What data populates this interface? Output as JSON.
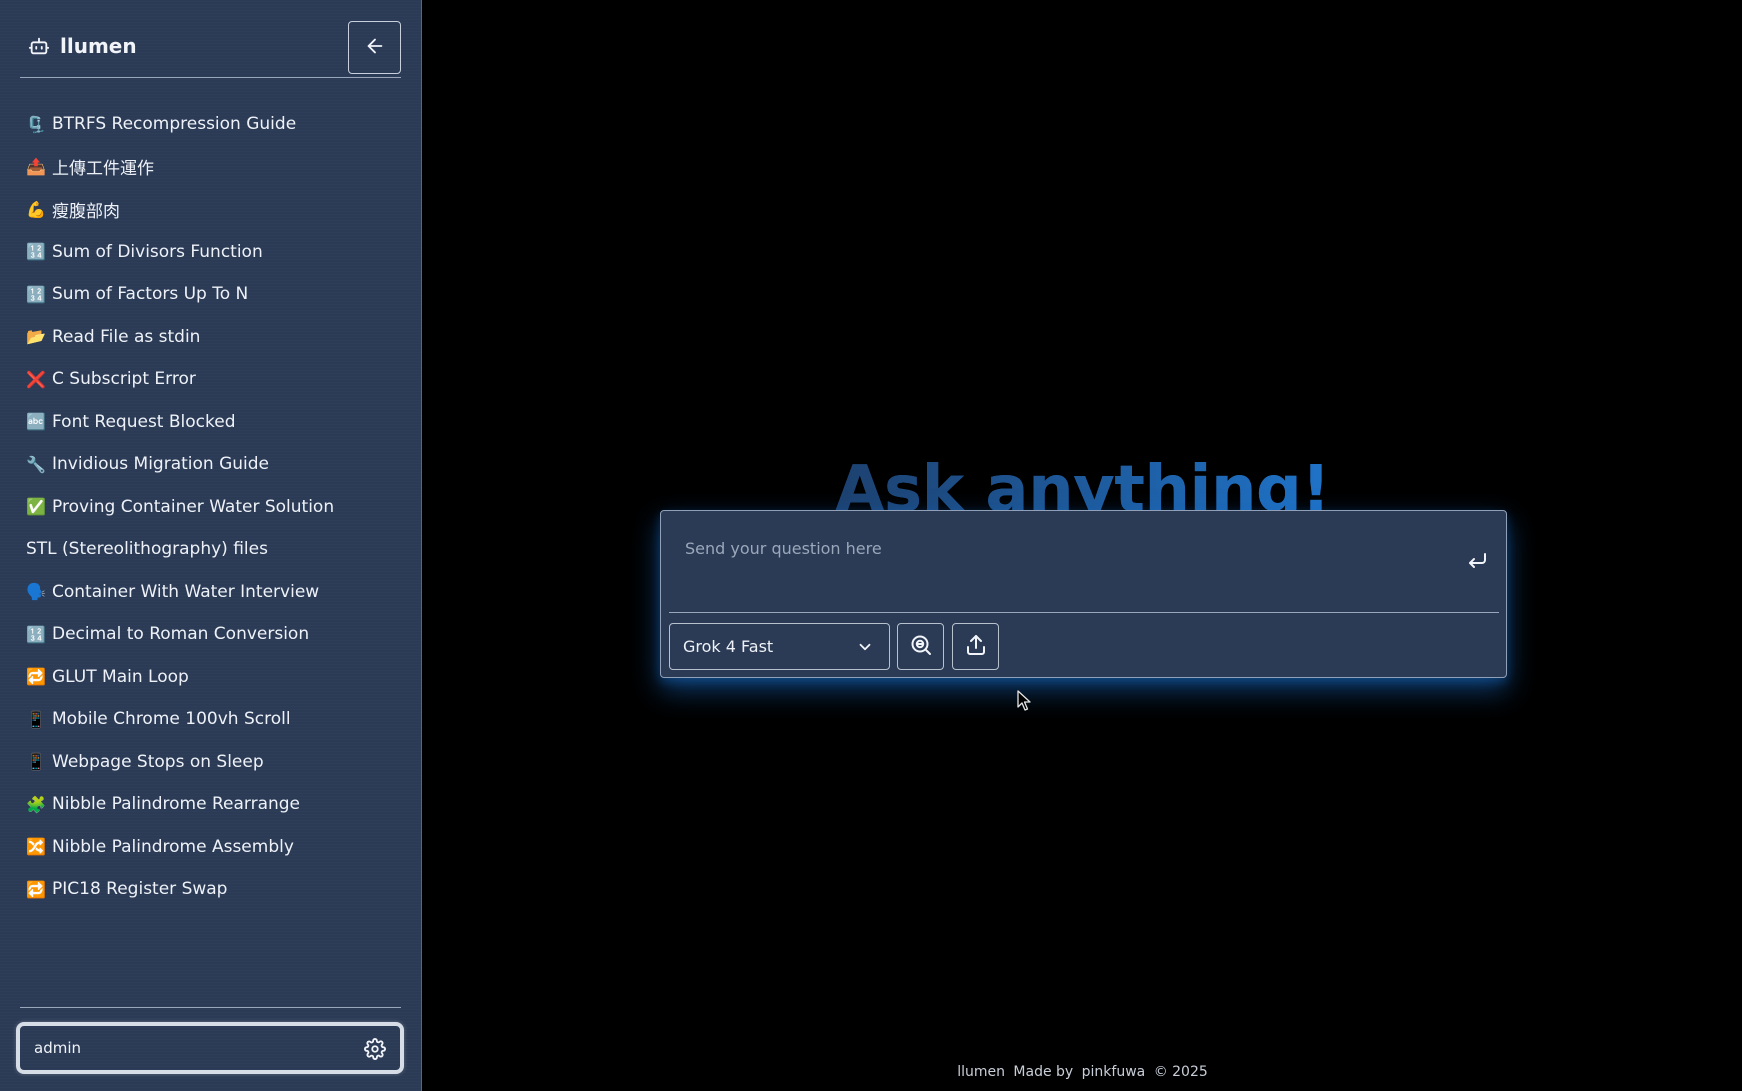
{
  "sidebar": {
    "brand": "llumen",
    "items": [
      {
        "emoji": "🗜️",
        "label": "BTRFS Recompression Guide"
      },
      {
        "emoji": "📤",
        "label": "上傳工件運作"
      },
      {
        "emoji": "💪",
        "label": "瘦腹部肉"
      },
      {
        "emoji": "🔢",
        "label": "Sum of Divisors Function"
      },
      {
        "emoji": "🔢",
        "label": "Sum of Factors Up To N"
      },
      {
        "emoji": "📂",
        "label": "Read File as stdin"
      },
      {
        "emoji": "❌",
        "label": "C Subscript Error"
      },
      {
        "emoji": "🔤",
        "label": "Font Request Blocked"
      },
      {
        "emoji": "🔧",
        "label": "Invidious Migration Guide"
      },
      {
        "emoji": "✅",
        "label": "Proving Container Water Solution"
      },
      {
        "emoji": "",
        "label": "STL (Stereolithography) files"
      },
      {
        "emoji": "🗣️",
        "label": "Container With Water Interview"
      },
      {
        "emoji": "🔢",
        "label": "Decimal to Roman Conversion"
      },
      {
        "emoji": "🔁",
        "label": "GLUT Main Loop"
      },
      {
        "emoji": "📱",
        "label": "Mobile Chrome 100vh Scroll"
      },
      {
        "emoji": "📱",
        "label": "Webpage Stops on Sleep"
      },
      {
        "emoji": "🧩",
        "label": "Nibble Palindrome Rearrange"
      },
      {
        "emoji": "🔀",
        "label": "Nibble Palindrome Assembly"
      },
      {
        "emoji": "🔁",
        "label": "PIC18 Register Swap"
      }
    ],
    "user": "admin"
  },
  "main": {
    "headline": "Ask anything!",
    "input_placeholder": "Send your question here",
    "model": "Grok 4 Fast"
  },
  "footer": {
    "app": "llumen",
    "made_by": "Made by",
    "author": "pinkfuwa",
    "copyright": "© 2025"
  },
  "colors": {
    "sidebar_bg": "#2b3a55",
    "page_bg": "#000000",
    "accent": "#1f73c8"
  },
  "icons": {
    "brand": "robot-icon",
    "collapse": "arrow-left-icon",
    "settings": "gear-icon",
    "send": "enter-return-icon",
    "model_dropdown": "chevron-down-icon",
    "search": "search-web-icon",
    "upload": "upload-icon"
  }
}
